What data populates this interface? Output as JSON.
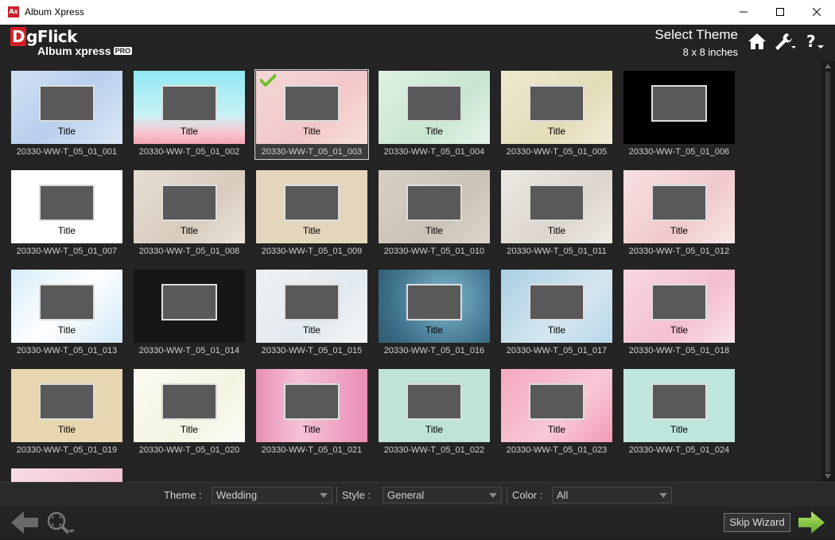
{
  "window": {
    "title": "Album Xpress",
    "icon_text": "Ax"
  },
  "header": {
    "logo_text": "gFlick",
    "logo_d": "D",
    "product": "Album xpress",
    "badge": "PRO",
    "heading": "Select Theme",
    "size": "8 x 8 inches"
  },
  "tiles": [
    {
      "title": "Title",
      "name": "20330-WW-T_05_01_001",
      "bg": "linear-gradient(135deg,#cfe0f2,#b8d0ee 50%,#dbe7f5)"
    },
    {
      "title": "Title",
      "name": "20330-WW-T_05_01_002",
      "bg": "linear-gradient(180deg,#8fe8f2,#c8f2f6 60%,#f7c6cf 85%,#f3a7b6)"
    },
    {
      "title": "Title",
      "name": "20330-WW-T_05_01_003",
      "bg": "linear-gradient(135deg,#f3d7d6,#f2c7c9 60%,#f8e2d8)"
    },
    {
      "title": "Title",
      "name": "20330-WW-T_05_01_004",
      "bg": "linear-gradient(135deg,#dff0e4,#c7e6cf 60%,#e8f4ec)"
    },
    {
      "title": "Title",
      "name": "20330-WW-T_05_01_005",
      "bg": "linear-gradient(135deg,#efe9d0,#e3dcb8 60%,#f2ecd6)"
    },
    {
      "title": "",
      "name": "20330-WW-T_05_01_006",
      "bg": "#000000"
    },
    {
      "title": "Title",
      "name": "20330-WW-T_05_01_007",
      "bg": "#ffffff"
    },
    {
      "title": "Title",
      "name": "20330-WW-T_05_01_008",
      "bg": "linear-gradient(135deg,#e6ddd2,#d7cbbd 60%,#ece4da)"
    },
    {
      "title": "Title",
      "name": "20330-WW-T_05_01_009",
      "bg": "#e3d6bd"
    },
    {
      "title": "Title",
      "name": "20330-WW-T_05_01_010",
      "bg": "linear-gradient(135deg,#d8d0c5,#cbc2b6 60%,#ddd6cc)"
    },
    {
      "title": "Title",
      "name": "20330-WW-T_05_01_011",
      "bg": "linear-gradient(135deg,#ece8e3,#dcd5cd 60%,#efebe6)"
    },
    {
      "title": "Title",
      "name": "20330-WW-T_05_01_012",
      "bg": "linear-gradient(135deg,#f8e1e0,#f0c9cb 60%,#fae9e8)"
    },
    {
      "title": "Title",
      "name": "20330-WW-T_05_01_013",
      "bg": "linear-gradient(135deg,#d6ecf8,#ffffff 50%,#cfe7f6)"
    },
    {
      "title": "",
      "name": "20330-WW-T_05_01_014",
      "bg": "#161616"
    },
    {
      "title": "Title",
      "name": "20330-WW-T_05_01_015",
      "bg": "linear-gradient(135deg,#eef2f4,#e2e9ee 60%,#f4f7f8)"
    },
    {
      "title": "Title",
      "name": "20330-WW-T_05_01_016",
      "bg": "radial-gradient(circle at 60% 40%,#7fb7cf,#3c6f88 70%,#2f5a70)"
    },
    {
      "title": "Title",
      "name": "20330-WW-T_05_01_017",
      "bg": "linear-gradient(135deg,#a9cfe3,#d4e6ef 60%,#b8d8ea)"
    },
    {
      "title": "Title",
      "name": "20330-WW-T_05_01_018",
      "bg": "linear-gradient(135deg,#f8d7e3,#f3bfd2 60%,#fbe3ec)"
    },
    {
      "title": "Title",
      "name": "20330-WW-T_05_01_019",
      "bg": "#e8d6b0"
    },
    {
      "title": "Title",
      "name": "20330-WW-T_05_01_020",
      "bg": "linear-gradient(135deg,#fbfbf1,#f3f4e2 60%,#fdfdf7)"
    },
    {
      "title": "Title",
      "name": "20330-WW-T_05_01_021",
      "bg": "linear-gradient(90deg,#e88fb4,#f5c3d8 40%,#e98db5)"
    },
    {
      "title": "Title",
      "name": "20330-WW-T_05_01_022",
      "bg": "#bfe3d6"
    },
    {
      "title": "Title",
      "name": "20330-WW-T_05_01_023",
      "bg": "linear-gradient(135deg,#f4a9bf,#f8c8d6 60%,#f29ab4)"
    },
    {
      "title": "Title",
      "name": "20330-WW-T_05_01_024",
      "bg": "#bfe6dd"
    }
  ],
  "filters": {
    "theme_label": "Theme :",
    "theme_value": "Wedding",
    "style_label": "Style :",
    "style_value": "General",
    "color_label": "Color :",
    "color_value": "All"
  },
  "footer": {
    "skip_label": "Skip Wizard"
  },
  "colors": {
    "accent_green": "#8cc63f",
    "logo_red": "#d51f26"
  }
}
